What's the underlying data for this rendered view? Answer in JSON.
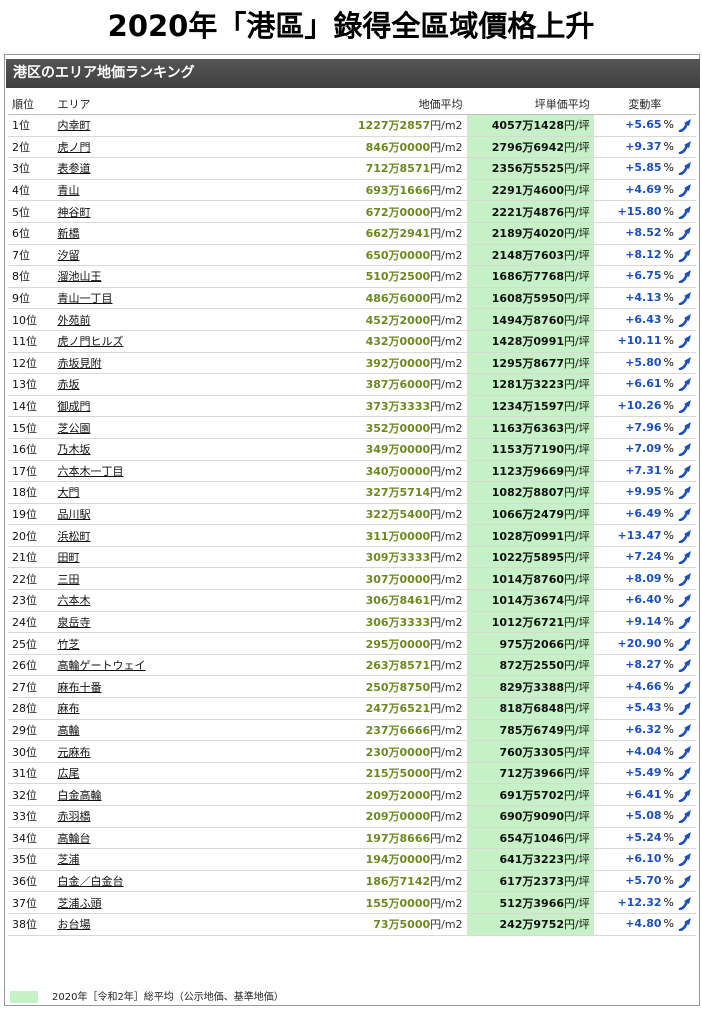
{
  "headline": "2020年「港區」錄得全區域價格上升",
  "section_title": "港区のエリア地価ランキング",
  "columns": {
    "rank": "順位",
    "area": "エリア",
    "price": "地価平均",
    "tsubo": "坪単価平均",
    "change": "変動率"
  },
  "units": {
    "price": "円/m2",
    "tsubo": "円/坪",
    "pct": "%"
  },
  "colors": {
    "tsubo_highlight": "#c6f0c6",
    "price_value": "#6b8a1e",
    "change_value": "#1a4fc4",
    "header_bg": "#444444"
  },
  "rows": [
    {
      "rank": "1位",
      "area": "内幸町",
      "price": "1227万2857",
      "tsubo": "4057万1428",
      "change": "+5.65"
    },
    {
      "rank": "2位",
      "area": "虎ノ門",
      "price": "846万0000",
      "tsubo": "2796万6942",
      "change": "+9.37"
    },
    {
      "rank": "3位",
      "area": "表参道",
      "price": "712万8571",
      "tsubo": "2356万5525",
      "change": "+5.85"
    },
    {
      "rank": "4位",
      "area": "青山",
      "price": "693万1666",
      "tsubo": "2291万4600",
      "change": "+4.69"
    },
    {
      "rank": "5位",
      "area": "神谷町",
      "price": "672万0000",
      "tsubo": "2221万4876",
      "change": "+15.80"
    },
    {
      "rank": "6位",
      "area": "新橋",
      "price": "662万2941",
      "tsubo": "2189万4020",
      "change": "+8.52"
    },
    {
      "rank": "7位",
      "area": "汐留",
      "price": "650万0000",
      "tsubo": "2148万7603",
      "change": "+8.12"
    },
    {
      "rank": "8位",
      "area": "溜池山王",
      "price": "510万2500",
      "tsubo": "1686万7768",
      "change": "+6.75"
    },
    {
      "rank": "9位",
      "area": "青山一丁目",
      "price": "486万6000",
      "tsubo": "1608万5950",
      "change": "+4.13"
    },
    {
      "rank": "10位",
      "area": "外苑前",
      "price": "452万2000",
      "tsubo": "1494万8760",
      "change": "+6.43"
    },
    {
      "rank": "11位",
      "area": "虎ノ門ヒルズ",
      "price": "432万0000",
      "tsubo": "1428万0991",
      "change": "+10.11"
    },
    {
      "rank": "12位",
      "area": "赤坂見附",
      "price": "392万0000",
      "tsubo": "1295万8677",
      "change": "+5.80"
    },
    {
      "rank": "13位",
      "area": "赤坂",
      "price": "387万6000",
      "tsubo": "1281万3223",
      "change": "+6.61"
    },
    {
      "rank": "14位",
      "area": "御成門",
      "price": "373万3333",
      "tsubo": "1234万1597",
      "change": "+10.26"
    },
    {
      "rank": "15位",
      "area": "芝公園",
      "price": "352万0000",
      "tsubo": "1163万6363",
      "change": "+7.96"
    },
    {
      "rank": "16位",
      "area": "乃木坂",
      "price": "349万0000",
      "tsubo": "1153万7190",
      "change": "+7.09"
    },
    {
      "rank": "17位",
      "area": "六本木一丁目",
      "price": "340万0000",
      "tsubo": "1123万9669",
      "change": "+7.31"
    },
    {
      "rank": "18位",
      "area": "大門",
      "price": "327万5714",
      "tsubo": "1082万8807",
      "change": "+9.95"
    },
    {
      "rank": "19位",
      "area": "品川駅",
      "price": "322万5400",
      "tsubo": "1066万2479",
      "change": "+6.49"
    },
    {
      "rank": "20位",
      "area": "浜松町",
      "price": "311万0000",
      "tsubo": "1028万0991",
      "change": "+13.47"
    },
    {
      "rank": "21位",
      "area": "田町",
      "price": "309万3333",
      "tsubo": "1022万5895",
      "change": "+7.24"
    },
    {
      "rank": "22位",
      "area": "三田",
      "price": "307万0000",
      "tsubo": "1014万8760",
      "change": "+8.09"
    },
    {
      "rank": "23位",
      "area": "六本木",
      "price": "306万8461",
      "tsubo": "1014万3674",
      "change": "+6.40"
    },
    {
      "rank": "24位",
      "area": "泉岳寺",
      "price": "306万3333",
      "tsubo": "1012万6721",
      "change": "+9.14"
    },
    {
      "rank": "25位",
      "area": "竹芝",
      "price": "295万0000",
      "tsubo": "975万2066",
      "change": "+20.90"
    },
    {
      "rank": "26位",
      "area": "高輪ゲートウェイ",
      "price": "263万8571",
      "tsubo": "872万2550",
      "change": "+8.27"
    },
    {
      "rank": "27位",
      "area": "麻布十番",
      "price": "250万8750",
      "tsubo": "829万3388",
      "change": "+4.66"
    },
    {
      "rank": "28位",
      "area": "麻布",
      "price": "247万6521",
      "tsubo": "818万6848",
      "change": "+5.43"
    },
    {
      "rank": "29位",
      "area": "高輪",
      "price": "237万6666",
      "tsubo": "785万6749",
      "change": "+6.32"
    },
    {
      "rank": "30位",
      "area": "元麻布",
      "price": "230万0000",
      "tsubo": "760万3305",
      "change": "+4.04"
    },
    {
      "rank": "31位",
      "area": "広尾",
      "price": "215万5000",
      "tsubo": "712万3966",
      "change": "+5.49"
    },
    {
      "rank": "32位",
      "area": "白金高輪",
      "price": "209万2000",
      "tsubo": "691万5702",
      "change": "+6.41"
    },
    {
      "rank": "33位",
      "area": "赤羽橋",
      "price": "209万0000",
      "tsubo": "690万9090",
      "change": "+5.08"
    },
    {
      "rank": "34位",
      "area": "高輪台",
      "price": "197万8666",
      "tsubo": "654万1046",
      "change": "+5.24"
    },
    {
      "rank": "35位",
      "area": "芝浦",
      "price": "194万0000",
      "tsubo": "641万3223",
      "change": "+6.10"
    },
    {
      "rank": "36位",
      "area": "白金／白金台",
      "price": "186万7142",
      "tsubo": "617万2373",
      "change": "+5.70"
    },
    {
      "rank": "37位",
      "area": "芝浦ふ頭",
      "price": "155万0000",
      "tsubo": "512万3966",
      "change": "+12.32"
    },
    {
      "rank": "38位",
      "area": "お台場",
      "price": "73万5000",
      "tsubo": "242万9752",
      "change": "+4.80"
    }
  ],
  "legend": "2020年［令和2年］総平均（公示地価、基準地価）"
}
